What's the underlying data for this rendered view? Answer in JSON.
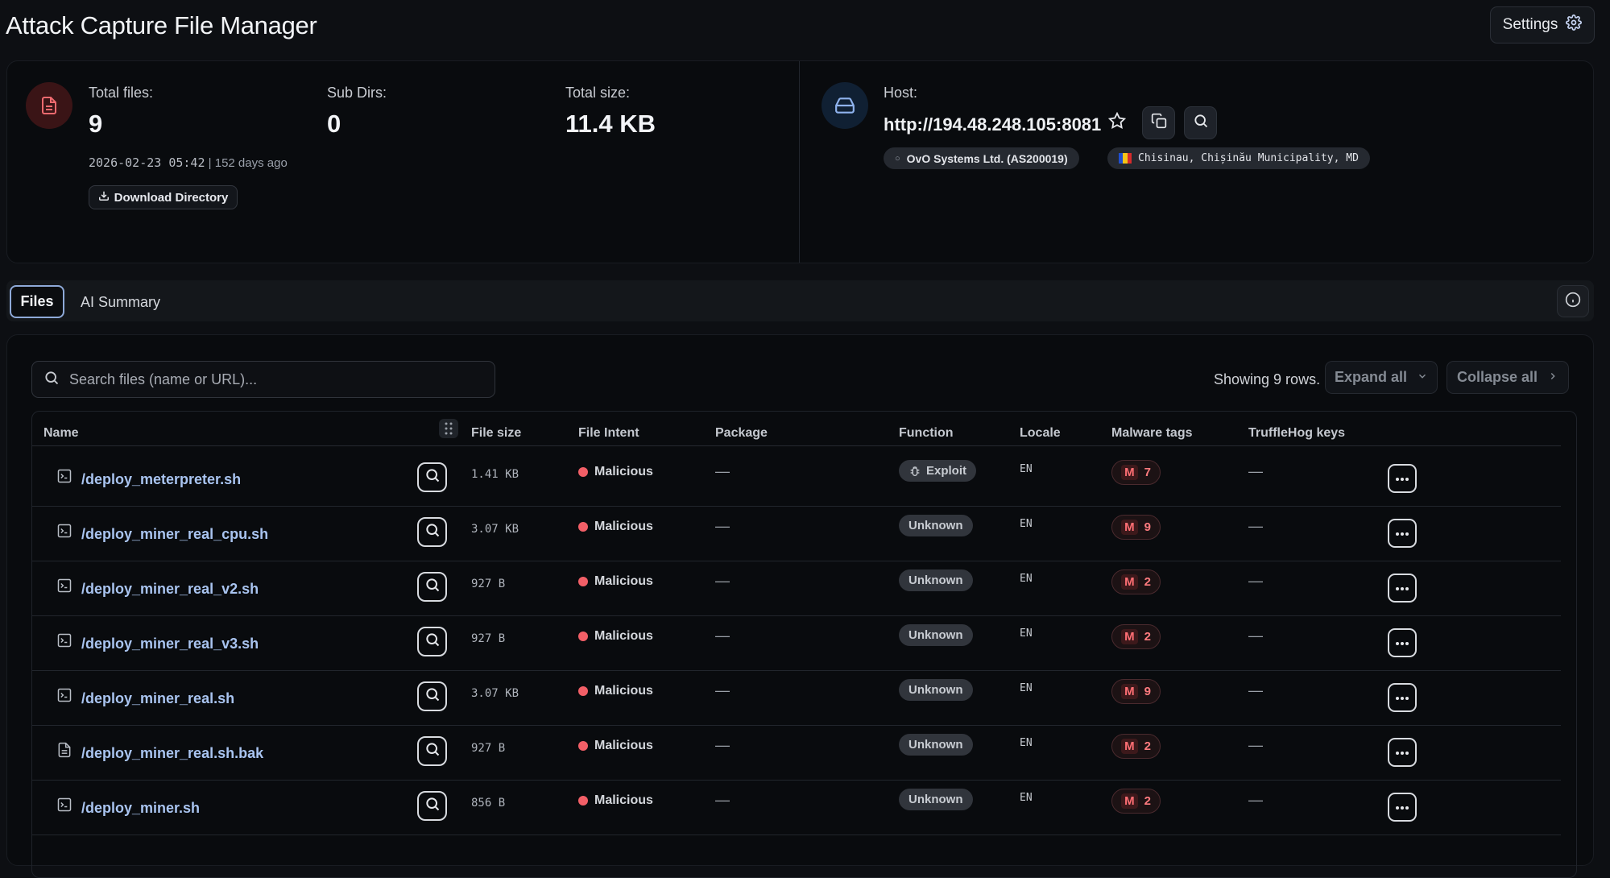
{
  "app": {
    "title": "Attack Capture File Manager",
    "settings_label": "Settings"
  },
  "summary": {
    "total_files_label": "Total files:",
    "total_files": "9",
    "sub_dirs_label": "Sub Dirs:",
    "sub_dirs": "0",
    "total_size_label": "Total size:",
    "total_size": "11.4 KB",
    "timestamp": "2026-02-23 05:42",
    "age": "| 152 days ago",
    "download_label": "Download Directory"
  },
  "host": {
    "label": "Host:",
    "url": "http://194.48.248.105:8081",
    "asn_chip": "OvO Systems Ltd. (AS200019)",
    "location_chip": "Chisinau, Chișinău Municipality, MD"
  },
  "tabs": {
    "files": "Files",
    "ai_summary": "AI Summary"
  },
  "toolbar": {
    "search_placeholder": "Search files (name or URL)...",
    "showing": "Showing 9 rows.",
    "expand_all": "Expand all",
    "collapse_all": "Collapse all"
  },
  "table": {
    "headers": {
      "name": "Name",
      "file_size": "File size",
      "file_intent": "File Intent",
      "package": "Package",
      "function": "Function",
      "locale": "Locale",
      "malware_tags": "Malware tags",
      "trufflehog": "TruffleHog keys"
    },
    "rows": [
      {
        "name": "/deploy_meterpreter.sh",
        "size": "1.41 KB",
        "intent": "Malicious",
        "package": "—",
        "function": "Exploit",
        "locale": "EN",
        "tag_letter": "M",
        "tag_count": "7",
        "truffle": "—",
        "icon": "terminal-file-icon"
      },
      {
        "name": "/deploy_miner_real_cpu.sh",
        "size": "3.07 KB",
        "intent": "Malicious",
        "package": "—",
        "function": "Unknown",
        "locale": "EN",
        "tag_letter": "M",
        "tag_count": "9",
        "truffle": "—",
        "icon": "terminal-file-icon"
      },
      {
        "name": "/deploy_miner_real_v2.sh",
        "size": "927 B",
        "intent": "Malicious",
        "package": "—",
        "function": "Unknown",
        "locale": "EN",
        "tag_letter": "M",
        "tag_count": "2",
        "truffle": "—",
        "icon": "terminal-file-icon"
      },
      {
        "name": "/deploy_miner_real_v3.sh",
        "size": "927 B",
        "intent": "Malicious",
        "package": "—",
        "function": "Unknown",
        "locale": "EN",
        "tag_letter": "M",
        "tag_count": "2",
        "truffle": "—",
        "icon": "terminal-file-icon"
      },
      {
        "name": "/deploy_miner_real.sh",
        "size": "3.07 KB",
        "intent": "Malicious",
        "package": "—",
        "function": "Unknown",
        "locale": "EN",
        "tag_letter": "M",
        "tag_count": "9",
        "truffle": "—",
        "icon": "terminal-file-icon"
      },
      {
        "name": "/deploy_miner_real.sh.bak",
        "size": "927 B",
        "intent": "Malicious",
        "package": "—",
        "function": "Unknown",
        "locale": "EN",
        "tag_letter": "M",
        "tag_count": "2",
        "truffle": "—",
        "icon": "text-file-icon"
      },
      {
        "name": "/deploy_miner.sh",
        "size": "856 B",
        "intent": "Malicious",
        "package": "—",
        "function": "Unknown",
        "locale": "EN",
        "tag_letter": "M",
        "tag_count": "2",
        "truffle": "—",
        "icon": "terminal-file-icon"
      }
    ]
  },
  "colors": {
    "background": "#0d0f13",
    "link": "#a9c4f0",
    "malicious": "#f25f67",
    "tab_active_border": "#8ea9d8"
  }
}
